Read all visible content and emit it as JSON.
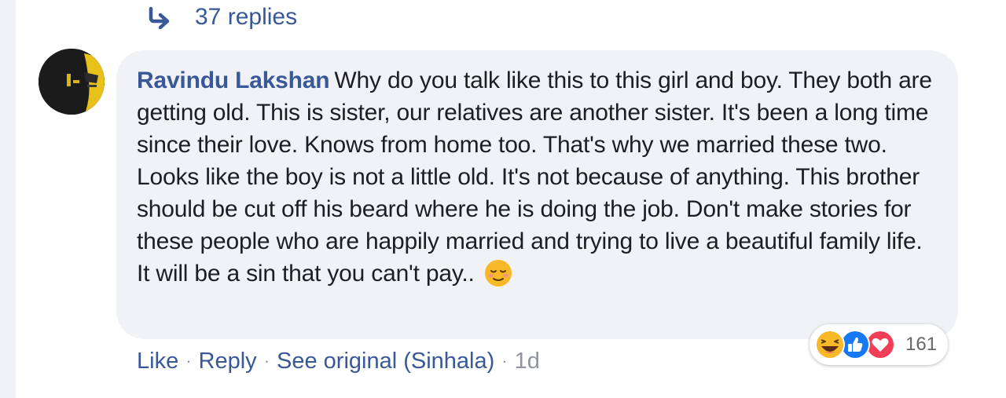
{
  "replies": {
    "label": "37 replies"
  },
  "comment": {
    "author": "Ravindu Lakshan",
    "text": "Why do you talk like this to this girl and boy. They both are getting old. This is sister, our relatives are another sister. It's been a long time since their love. Knows from home too. That's why we married these two. Looks like the boy is not a little old. It's not because of anything. This brother should be cut off his beard where he is doing the job. Don't make stories for these people who are happily married and trying to live a beautiful family life. It will be a sin that you can't pay..",
    "emoji_icon": "relieved-face-icon"
  },
  "reactions": {
    "icons": [
      "haha-icon",
      "like-icon",
      "love-icon"
    ],
    "count": "161"
  },
  "actions": {
    "like": "Like",
    "reply": "Reply",
    "see_original": "See original (Sinhala)",
    "time": "1d",
    "separator": "·"
  },
  "colors": {
    "link": "#385898",
    "bubble": "#f0f2f5",
    "text": "#1c1e21",
    "muted": "#90949c"
  }
}
